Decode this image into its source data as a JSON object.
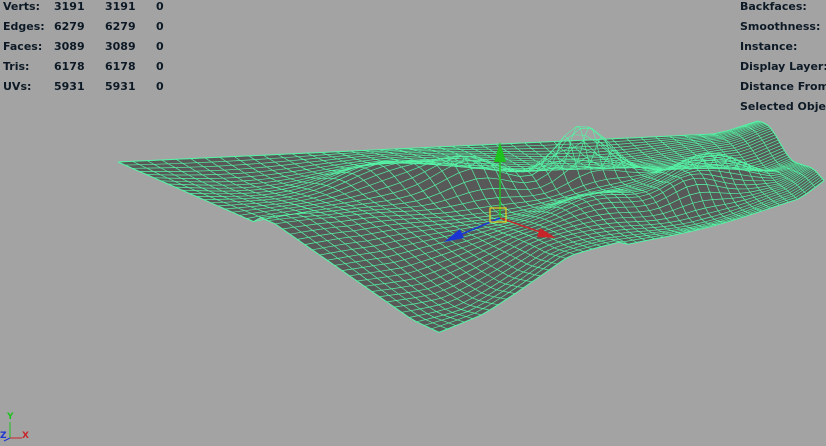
{
  "hud_stats": {
    "rows": [
      {
        "label": "Verts:",
        "v1": "3191",
        "v2": "3191",
        "v3": "0"
      },
      {
        "label": "Edges:",
        "v1": "6279",
        "v2": "6279",
        "v3": "0"
      },
      {
        "label": "Faces:",
        "v1": "3089",
        "v2": "3089",
        "v3": "0"
      },
      {
        "label": "Tris:",
        "v1": "6178",
        "v2": "6178",
        "v3": "0"
      },
      {
        "label": "UVs:",
        "v1": "5931",
        "v2": "5931",
        "v3": "0"
      }
    ]
  },
  "hud_info": {
    "items": [
      "Backfaces:",
      "Smoothness:",
      "Instance:",
      "Display Layer:",
      "Distance From C",
      "Selected Object"
    ]
  },
  "axis": {
    "y_label": "Y",
    "z_label": "Z",
    "x_label": "X"
  },
  "colors": {
    "background": "#a3a3a3",
    "mesh_fill": "#585858",
    "wire": "#55f2a4",
    "hud_text": "#0d1a26",
    "manip_y": "#1ec21e",
    "manip_x": "#c8252a",
    "manip_z": "#1b35d2",
    "manip_center": "#e5d21a"
  }
}
